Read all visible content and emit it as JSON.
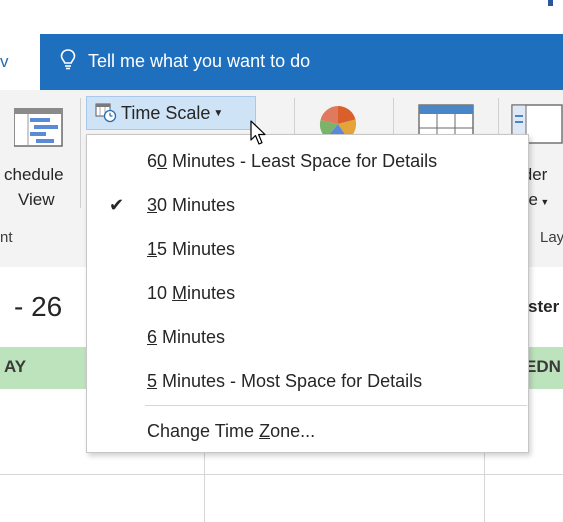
{
  "tellme": {
    "text": "Tell me what you want to do",
    "icon": "lightbulb-icon"
  },
  "active_tab": {
    "label_fragment": "v"
  },
  "ribbon": {
    "schedule_view": {
      "line1": "chedule",
      "line2": "View",
      "group": "nt"
    },
    "time_scale": {
      "label": "Time Scale",
      "icon": "calendar-clock-icon"
    },
    "calendar_colors_icon": "pie-chart-icon",
    "grid_icon": "grid-view-icon",
    "folder_pane": {
      "line1": "lder",
      "line2": "ne",
      "group": "Lay"
    }
  },
  "calendar": {
    "date_range": "- 26",
    "weekday_left": "AY",
    "weekday_right": "EDN",
    "right_text": "ster"
  },
  "time_scale_menu": {
    "items": [
      {
        "label": "60 Minutes - Least Space for Details",
        "accel_pre": "6",
        "accel": "0",
        "accel_post": " Minutes - Least Space for Details",
        "checked": false
      },
      {
        "label": "30 Minutes",
        "accel_pre": "",
        "accel": "3",
        "accel_post": "0 Minutes",
        "checked": true
      },
      {
        "label": "15 Minutes",
        "accel_pre": "",
        "accel": "1",
        "accel_post": "5 Minutes",
        "checked": false
      },
      {
        "label": "10 Minutes",
        "accel_pre": "10 ",
        "accel": "M",
        "accel_post": "inutes",
        "checked": false
      },
      {
        "label": "6 Minutes",
        "accel_pre": "",
        "accel": "6",
        "accel_post": " Minutes",
        "checked": false
      },
      {
        "label": "5 Minutes - Most Space for Details",
        "accel_pre": "",
        "accel": "5",
        "accel_post": " Minutes - Most Space for Details",
        "checked": false
      }
    ],
    "change_time_zone": {
      "pre": "Change Time ",
      "accel": "Z",
      "post": "one..."
    }
  },
  "colors": {
    "ribbon_blue": "#1f6fbf",
    "weekday_green": "#bde3bd",
    "button_hover": "#cfe3f7"
  }
}
